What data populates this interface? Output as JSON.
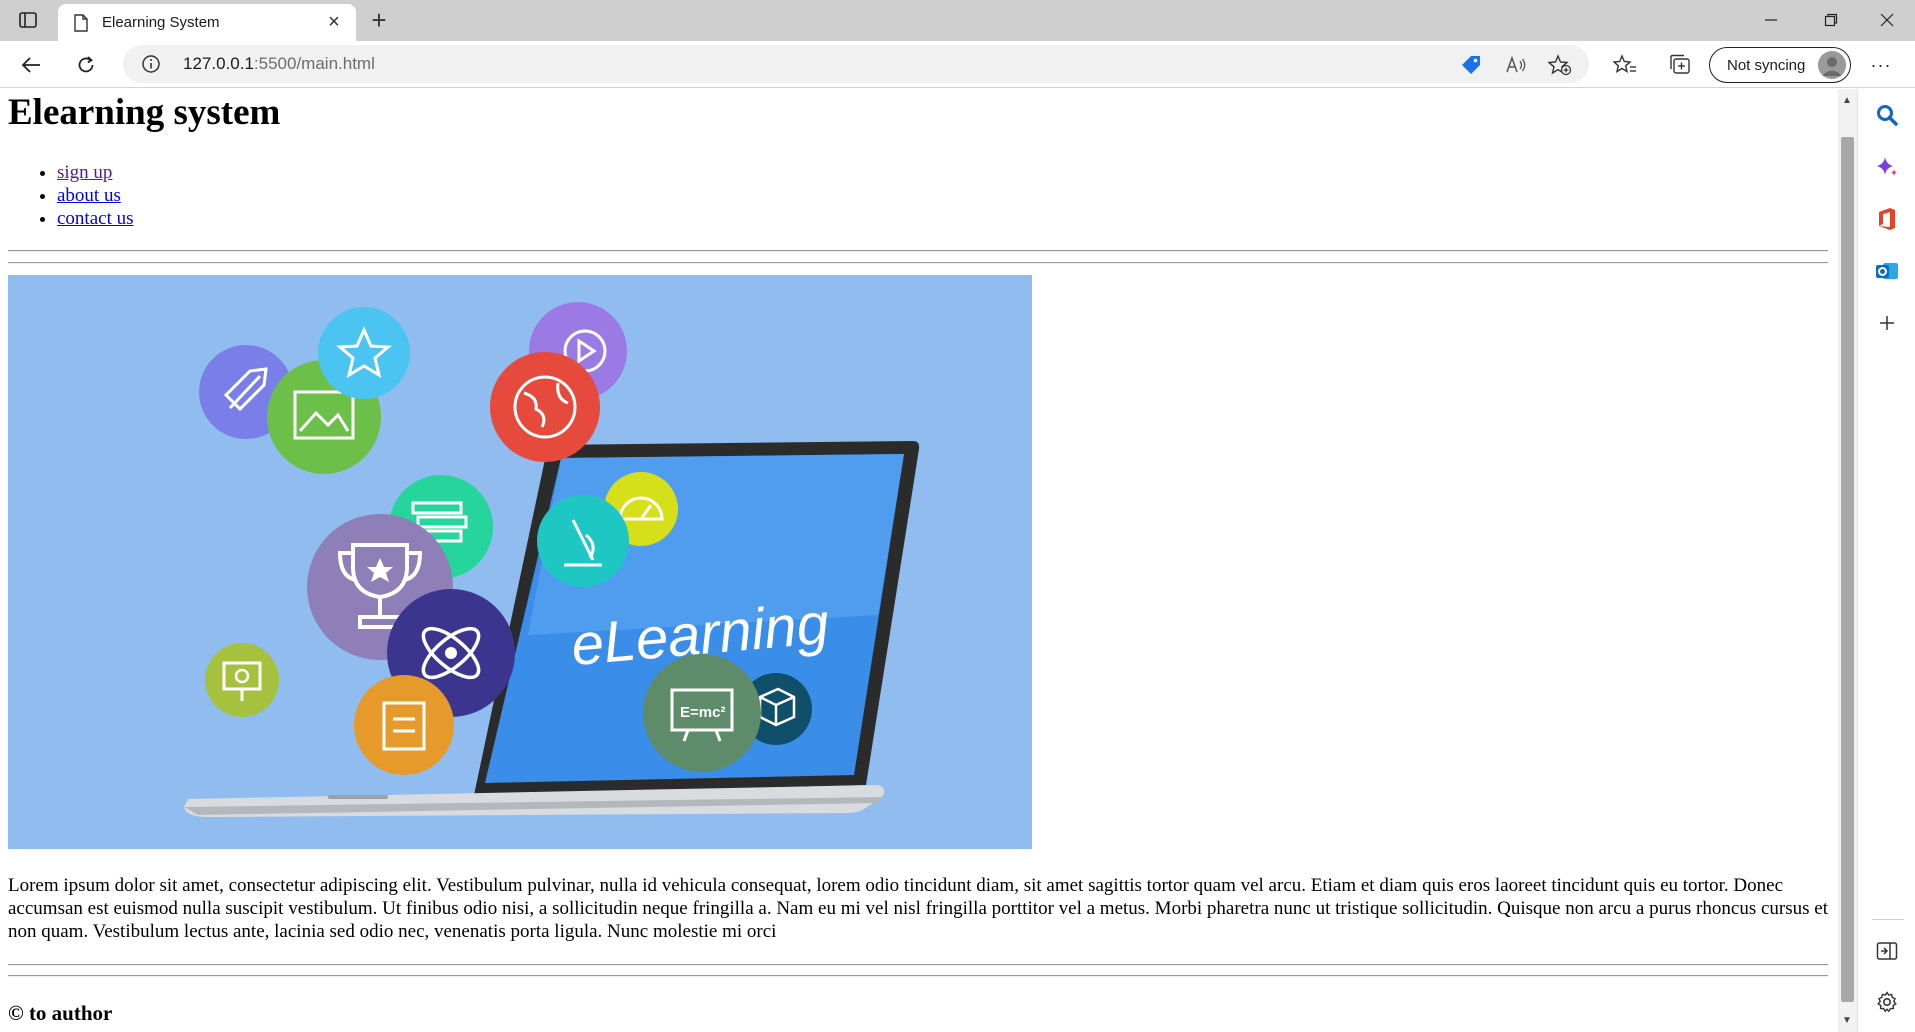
{
  "browser": {
    "tab_title": "Elearning System",
    "new_tab": "+",
    "url_host": "127.0.0.1",
    "url_path": ":5500/main.html",
    "sync_label": "Not syncing",
    "more_label": "···"
  },
  "page": {
    "heading": "Elearning system",
    "nav_links": [
      {
        "label": "sign up"
      },
      {
        "label": "about us"
      },
      {
        "label": "contact us"
      }
    ],
    "hero": {
      "screen_text": "eLearning",
      "formula_text": "E=mc²"
    },
    "paragraph": "Lorem ipsum dolor sit amet, consectetur adipiscing elit. Vestibulum pulvinar, nulla id vehicula consequat, lorem odio tincidunt diam, sit amet sagittis tortor quam vel arcu. Etiam et diam quis eros laoreet tincidunt quis eu tortor. Donec accumsan est euismod nulla suscipit vestibulum. Ut finibus odio nisi, a sollicitudin neque fringilla a. Nam eu mi vel nisl fringilla porttitor vel a metus. Morbi pharetra nunc ut tristique sollicitudin. Quisque non arcu a purus rhoncus cursus et non quam. Vestibulum lectus ante, lacinia sed odio nec, venenatis porta ligula. Nunc molestie mi orci",
    "footer": "© to author"
  },
  "colors": {
    "link": "#0000ee",
    "visited_link": "#551a8b",
    "hero_background": "#90bcf0"
  }
}
